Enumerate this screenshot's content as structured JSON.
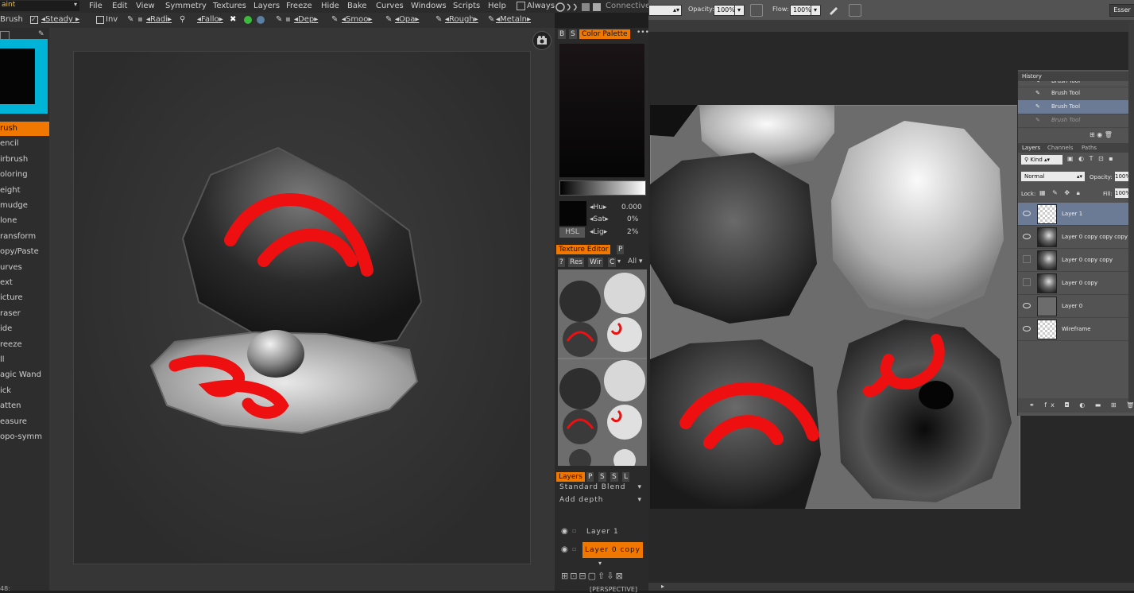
{
  "coat": {
    "mode_dropdown": "aint",
    "menu": [
      "File",
      "Edit",
      "View",
      "Symmetry",
      "Textures",
      "Layers",
      "Freeze",
      "Hide",
      "Bake",
      "Curves",
      "Windows",
      "Scripts",
      "Help"
    ],
    "always_label": "Always",
    "connective_label": "Connective",
    "toolbar": {
      "brush_label": "Brush",
      "steady_label": "Steady",
      "inv_label": "Inv",
      "radius_label": "Radi",
      "falloff_label": "Fallo",
      "depth_label": "Dep",
      "smooth_label": "Smoo",
      "opacity_label": "Opa",
      "rough_label": "Rough",
      "metal_label": "Metaln"
    },
    "tools": [
      {
        "label": "rush",
        "active": true
      },
      {
        "label": "encil",
        "active": false
      },
      {
        "label": "irbrush",
        "active": false
      },
      {
        "label": "oloring",
        "active": false
      },
      {
        "label": "eight",
        "active": false
      },
      {
        "label": "mudge",
        "active": false
      },
      {
        "label": "lone",
        "active": false
      },
      {
        "label": "ransform",
        "active": false
      },
      {
        "label": "opy/Paste",
        "active": false
      },
      {
        "label": "urves",
        "active": false
      },
      {
        "label": "ext",
        "active": false
      },
      {
        "label": "icture",
        "active": false
      },
      {
        "label": "raser",
        "active": false
      },
      {
        "label": "ide",
        "active": false
      },
      {
        "label": "reeze",
        "active": false
      },
      {
        "label": "ll",
        "active": false
      },
      {
        "label": "agic Wand",
        "active": false
      },
      {
        "label": "ick",
        "active": false
      },
      {
        "label": "atten",
        "active": false
      },
      {
        "label": "easure",
        "active": false
      },
      {
        "label": "opo-symm",
        "active": false
      }
    ],
    "status_left": "48:",
    "status_bottom": "[PERSPECTIVE]",
    "color_palette": {
      "tab_b": "B",
      "tab_s": "S",
      "title": "Color Palette",
      "hue_label": "Hu",
      "hue_value": "0.000",
      "sat_label": "Sat",
      "sat_value": "0%",
      "lig_label": "Lig",
      "lig_value": "2%",
      "mode_button": "HSL"
    },
    "texture_editor": {
      "title": "Texture Editor",
      "tab_p": "P",
      "btn_q": "?",
      "btn_res": "Res",
      "btn_wir": "Wir",
      "btn_c": "C",
      "btn_all": "All"
    },
    "layers_panel": {
      "title": "Layers",
      "tabs": [
        "P",
        "S",
        "S",
        "L"
      ],
      "blend_mode": "Standard Blend",
      "depth_mode": "Add depth",
      "layers": [
        "Layer 1",
        "Layer 0 copy"
      ]
    }
  },
  "ps": {
    "opacity_label": "Opacity:",
    "opacity_value": "100%",
    "flow_label": "Flow:",
    "flow_value": "100%",
    "workspace_label": "Esser",
    "history": {
      "title": "History",
      "items": [
        "Brush Tool",
        "Brush Tool",
        "Brush Tool",
        "Brush Tool"
      ]
    },
    "layers": {
      "tabs": [
        "Layers",
        "Channels",
        "Paths"
      ],
      "kind_label": "Kind",
      "blend_mode": "Normal",
      "opacity_label": "Opacity:",
      "opacity_value": "100%",
      "lock_label": "Lock:",
      "fill_label": "Fill:",
      "fill_value": "100%",
      "items": [
        "Layer 1",
        "Layer 0 copy copy copy",
        "Layer 0 copy copy",
        "Layer 0 copy",
        "Layer 0",
        "Wireframe"
      ]
    }
  },
  "colors": {
    "accent": "#f07800",
    "paint": "#ee1010"
  }
}
